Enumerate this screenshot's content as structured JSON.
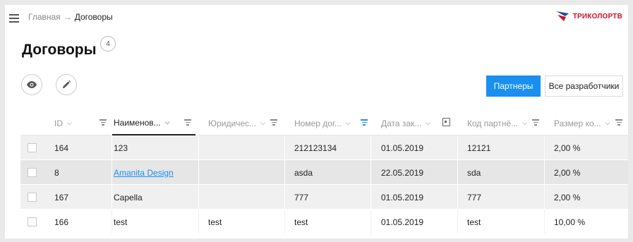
{
  "breadcrumb": {
    "home": "Главная",
    "separator": "→",
    "current": "Договоры"
  },
  "logo": {
    "text": "ТРИКОЛОРТВ",
    "colors": {
      "blue": "#1a4fa3",
      "red": "#d0112b"
    }
  },
  "page": {
    "title": "Договоры",
    "count": "4"
  },
  "toolbar": {
    "view_icon": "eye-icon",
    "edit_icon": "pencil-icon"
  },
  "segment": {
    "partners": "Партнеры",
    "all_developers": "Все разработчики",
    "active_color": "#1a8ff0"
  },
  "table": {
    "columns": [
      {
        "label": "ID",
        "chevron": "⌵"
      },
      {
        "label": "Наименов...",
        "chevron": "⌵"
      },
      {
        "label": "Юридичес...",
        "chevron": "⌵"
      },
      {
        "label": "Номер дог...",
        "chevron": "⌵"
      },
      {
        "label": "Дата зак...",
        "chevron": "⌵"
      },
      {
        "label": "Код партнё...",
        "chevron": "⌵"
      },
      {
        "label": "Размер ко...",
        "chevron": "⌵"
      }
    ],
    "rows": [
      {
        "id": "164",
        "name": "123",
        "legal": "",
        "number": "212123134",
        "date": "01.05.2019",
        "partner_code": "12121",
        "size": "2,00 %"
      },
      {
        "id": "8",
        "name": "Amanita Design",
        "legal": "",
        "number": "asda",
        "date": "22.05.2019",
        "partner_code": "sda",
        "size": "2,00 %"
      },
      {
        "id": "167",
        "name": "Capella",
        "legal": "",
        "number": "777",
        "date": "01.05.2019",
        "partner_code": "777",
        "size": "2,00 %"
      },
      {
        "id": "166",
        "name": "test",
        "legal": "test",
        "number": "test",
        "date": "01.05.2019",
        "partner_code": "test",
        "size": "10,00 %"
      }
    ]
  }
}
